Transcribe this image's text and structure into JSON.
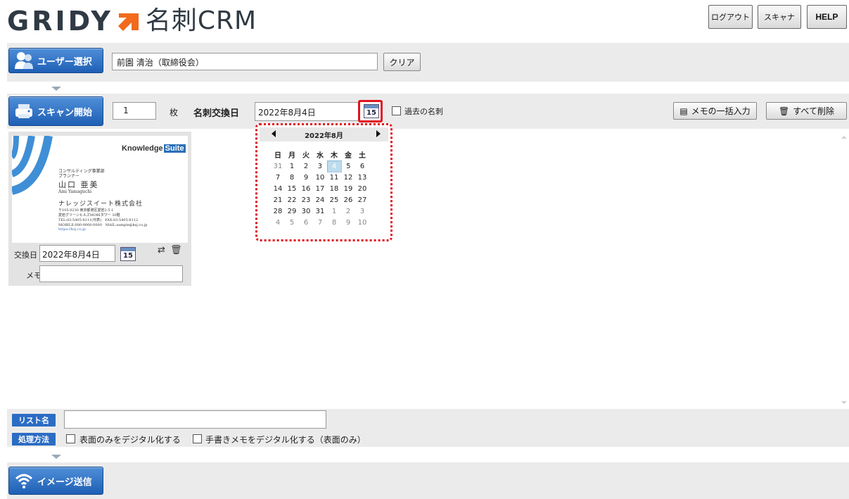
{
  "header": {
    "logo_text": "GRIDY",
    "product_name": "名刺CRM",
    "logout_label": "ログアウト",
    "scanner_label": "スキャナ",
    "help_label": "HELP"
  },
  "user_section": {
    "select_user_label": "ユーザー選択",
    "user_value": "前園 清治（取締役会）",
    "clear_label": "クリア"
  },
  "scan_section": {
    "start_scan_label": "スキャン開始",
    "count_value": "1",
    "count_unit": "枚",
    "exchange_date_label": "名刺交換日",
    "exchange_date_value": "2022年8月4日",
    "calendar_icon_text": "15",
    "past_cards_label": "過去の名刺",
    "bulk_memo_label": "メモの一括入力",
    "delete_all_label": "すべて削除"
  },
  "date_picker": {
    "title": "2022年8月",
    "weekdays": [
      "日",
      "月",
      "火",
      "水",
      "木",
      "金",
      "土"
    ],
    "weeks": [
      [
        "31",
        "1",
        "2",
        "3",
        "4",
        "5",
        "6"
      ],
      [
        "7",
        "8",
        "9",
        "10",
        "11",
        "12",
        "13"
      ],
      [
        "14",
        "15",
        "16",
        "17",
        "18",
        "19",
        "20"
      ],
      [
        "21",
        "22",
        "23",
        "24",
        "25",
        "26",
        "27"
      ],
      [
        "28",
        "29",
        "30",
        "31",
        "1",
        "2",
        "3"
      ],
      [
        "4",
        "5",
        "6",
        "7",
        "8",
        "9",
        "10"
      ]
    ],
    "selected_day": "4"
  },
  "card": {
    "brand": "Knowledge",
    "brand_suite": "Suite",
    "dept": "コンサルティング事業部",
    "title": "プランナー",
    "name": "山口 亜美",
    "name_roman": "Ami Yamaguchi",
    "company": "ナレッジスイート株式会社",
    "addr1": "〒105-0230 東京都港区愛宕2-5-1",
    "addr2": "愛宕グリーンヒルズMORIタワー 30階",
    "addr3": "TEL:03-5405-8111(代表)　FAX:03-5405-8112",
    "addr4": "MOBILE:080-0000-0000　MAIL:sample@ksj.co.jp",
    "url": "https://ksj.co.jp",
    "exchange_label": "交換日",
    "exchange_value": "2022年8月4日",
    "memo_label": "メモ",
    "memo_value": ""
  },
  "options": {
    "list_name_tag": "リスト名",
    "list_name_value": "",
    "process_tag": "処理方法",
    "front_only_label": "表面のみをデジタル化する",
    "handwritten_label": "手書きメモをデジタル化する（表面のみ）"
  },
  "send_section": {
    "send_image_label": "イメージ送信"
  },
  "colors": {
    "brand_orange": "#f26a1b",
    "accent_blue": "#2b6cc4",
    "highlight_red": "#e0141d"
  }
}
